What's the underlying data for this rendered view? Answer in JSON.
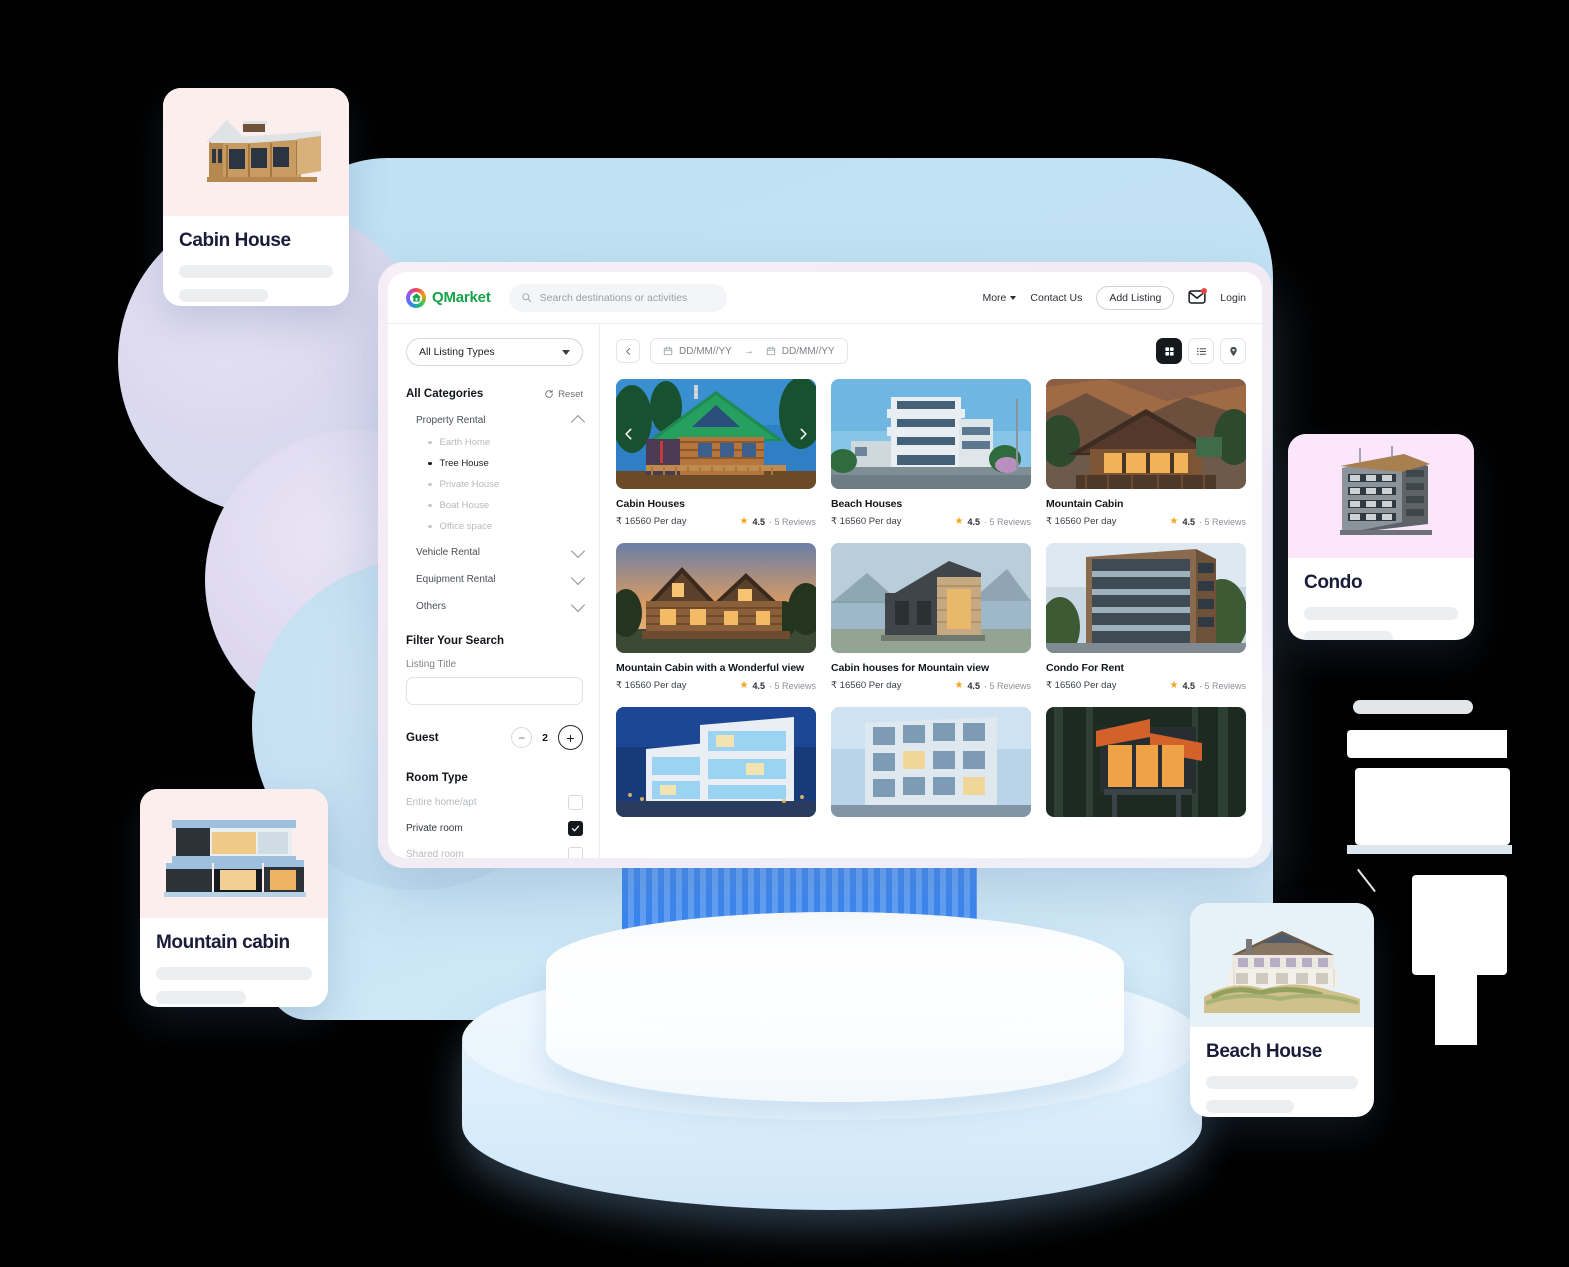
{
  "brand": {
    "name": "QMarket"
  },
  "header": {
    "search_placeholder": "Search destinations or activities",
    "more_label": "More",
    "contact_label": "Contact Us",
    "add_listing_label": "Add Listing",
    "login_label": "Login",
    "mail_icon": "mail-icon",
    "search_icon": "search-icon"
  },
  "sidebar": {
    "listing_type_value": "All Listing Types",
    "categories_title": "All Categories",
    "reset_label": "Reset",
    "groups": [
      {
        "label": "Property Rental",
        "expanded": true,
        "items": [
          {
            "label": "Earth Home",
            "selected": false
          },
          {
            "label": "Tree House",
            "selected": true
          },
          {
            "label": "Private House",
            "selected": false
          },
          {
            "label": "Boat House",
            "selected": false
          },
          {
            "label": "Office space",
            "selected": false
          }
        ]
      },
      {
        "label": "Vehicle Rental",
        "expanded": false,
        "items": []
      },
      {
        "label": "Equipment Rental",
        "expanded": false,
        "items": []
      },
      {
        "label": "Others",
        "expanded": false,
        "items": []
      }
    ],
    "filter_title": "Filter Your Search",
    "listing_title_label": "Listing Title",
    "listing_title_value": "",
    "guest_label": "Guest",
    "guest_count": "2",
    "room_type_label": "Room Type",
    "room_types": [
      {
        "label": "Entire home/apt",
        "checked": false
      },
      {
        "label": "Private room",
        "checked": true
      },
      {
        "label": "Shared room",
        "checked": false
      }
    ]
  },
  "toolbar": {
    "date_from": "DD/MM//YY",
    "date_to": "DD/MM//YY",
    "arrow": "→",
    "views": [
      {
        "name": "grid-view",
        "active": true
      },
      {
        "name": "list-view",
        "active": false
      },
      {
        "name": "map-view",
        "active": false
      }
    ]
  },
  "listings": [
    {
      "title": "Cabin Houses",
      "price": "₹ 16560 Per day",
      "rating": "4.5",
      "reviews": "· 5 Reviews"
    },
    {
      "title": "Beach Houses",
      "price": "₹ 16560 Per day",
      "rating": "4.5",
      "reviews": "· 5 Reviews"
    },
    {
      "title": "Mountain Cabin",
      "price": "₹ 16560 Per day",
      "rating": "4.5",
      "reviews": "· 5 Reviews"
    },
    {
      "title": "Mountain Cabin with a Wonderful view",
      "price": "₹ 16560 Per day",
      "rating": "4.5",
      "reviews": "· 5 Reviews"
    },
    {
      "title": "Cabin houses for Mountain view",
      "price": "₹ 16560 Per day",
      "rating": "4.5",
      "reviews": "· 5 Reviews"
    },
    {
      "title": "Condo For Rent",
      "price": "₹ 16560 Per day",
      "rating": "4.5",
      "reviews": "· 5 Reviews"
    }
  ],
  "feature_cards": [
    {
      "title": "Cabin House"
    },
    {
      "title": "Condo"
    },
    {
      "title": "Mountain cabin"
    },
    {
      "title": "Beach House"
    }
  ],
  "colors": {
    "brand_green": "#16a34a",
    "star_amber": "#f5a524",
    "dark": "#15181c",
    "notification_red": "#ef4444",
    "stage_blue": "#bfe0f3"
  }
}
